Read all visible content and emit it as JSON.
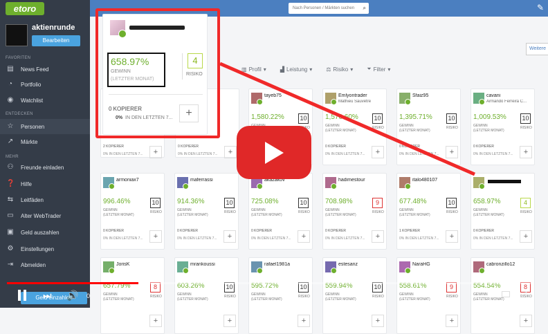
{
  "app": {
    "logo": "etoro"
  },
  "profile": {
    "name": "aktienrunde",
    "edit_label": "Bearbeiten"
  },
  "sidebar": {
    "section_favorites": "FAVORITEN",
    "section_discover": "ENTDECKEN",
    "section_more": "MEHR",
    "items": [
      {
        "label": "News Feed",
        "icon": "news-icon"
      },
      {
        "label": "Portfolio",
        "icon": "pie-chart-icon"
      },
      {
        "label": "Watchlist",
        "icon": "eye-icon"
      },
      {
        "label": "Personen",
        "icon": "star-icon"
      },
      {
        "label": "Märkte",
        "icon": "chart-icon"
      },
      {
        "label": "Freunde einladen",
        "icon": "people-icon"
      },
      {
        "label": "Hilfe",
        "icon": "help-icon"
      },
      {
        "label": "Leitfäden",
        "icon": "guide-icon"
      },
      {
        "label": "Alter WebTrader",
        "icon": "monitor-icon"
      },
      {
        "label": "Geld auszahlen",
        "icon": "money-icon"
      },
      {
        "label": "Einstellungen",
        "icon": "gear-icon"
      },
      {
        "label": "Abmelden",
        "icon": "logout-icon"
      }
    ],
    "deposit_label": "Geld einzahlen"
  },
  "search": {
    "placeholder": "Nach Personen / Märkten suchen"
  },
  "filters": {
    "profile": "Profil",
    "performance": "Leistung",
    "risk": "Risiko",
    "filter": "Filter",
    "more": "Weitere"
  },
  "highlight": {
    "gain": "658.97%",
    "gain_label": "GEWINN",
    "gain_period": "(LETZTER MONAT)",
    "risk": "4",
    "risk_label": "RISIKO",
    "copiers": "0 KOPIERER",
    "copiers_pct": "0%",
    "copiers_period": "IN DEN LETZTEN 7..."
  },
  "cards": [
    {
      "name": "tayeb75",
      "sub": "",
      "gain": "1,580.22%",
      "risk": "10",
      "copiers": "0 KOPIERER",
      "period": "0% IN DEN LETZTEN 7..."
    },
    {
      "name": "Emlyontrader",
      "sub": "Mathieu Sauvetre",
      "gain": "1,570.60%",
      "risk": "10",
      "copiers": "0 KOPIERER",
      "period": "0% IN DEN LETZTEN 7..."
    },
    {
      "name": "Sfaiz95",
      "sub": "",
      "gain": "1,395.71%",
      "risk": "10",
      "copiers": "0 KOPIERER",
      "period": "0% IN DEN LETZTEN 7..."
    },
    {
      "name": "cavani",
      "sub": "Armando Ferreira C...",
      "gain": "1,009.53%",
      "risk": "10",
      "copiers": "0 KOPIERER",
      "period": "0% IN DEN LETZTEN 7..."
    },
    {
      "name": "armoniax7",
      "sub": "",
      "gain": "996.46%",
      "risk": "10",
      "copiers": "0 KOPIERER",
      "period": "0% IN DEN LETZTEN 7..."
    },
    {
      "name": "maferrassi",
      "sub": "",
      "gain": "914.36%",
      "risk": "10",
      "copiers": "0 KOPIERER",
      "period": "0% IN DEN LETZTEN 7..."
    },
    {
      "name": "akazakov",
      "sub": "",
      "gain": "725.08%",
      "risk": "10",
      "copiers": "0 KOPIERER",
      "period": "0% IN DEN LETZTEN 7..."
    },
    {
      "name": "hadimestour",
      "sub": "",
      "gain": "708.98%",
      "risk": "9",
      "copiers": "0 KOPIERER",
      "period": "0% IN DEN LETZTEN 7..."
    },
    {
      "name": "italo480107",
      "sub": "",
      "gain": "677.48%",
      "risk": "10",
      "copiers": "1 KOPIERER",
      "period": "0% IN DEN LETZTEN 7..."
    },
    {
      "name": "",
      "sub": "",
      "gain": "658.97%",
      "risk": "4",
      "copiers": "0 KOPIERER",
      "period": "0% IN DEN LETZTEN 7..."
    },
    {
      "name": "JorisK",
      "sub": "",
      "gain": "657.79%",
      "risk": "8",
      "copiers": "",
      "period": ""
    },
    {
      "name": "mrankoussi",
      "sub": "",
      "gain": "603.26%",
      "risk": "10",
      "copiers": "",
      "period": ""
    },
    {
      "name": "rafael1981a",
      "sub": "",
      "gain": "595.72%",
      "risk": "10",
      "copiers": "",
      "period": ""
    },
    {
      "name": "estesanz",
      "sub": "",
      "gain": "559.94%",
      "risk": "10",
      "copiers": "",
      "period": ""
    },
    {
      "name": "NaraHG",
      "sub": "",
      "gain": "558.61%",
      "risk": "9",
      "copiers": "",
      "period": ""
    },
    {
      "name": "cabronzillo12",
      "sub": "",
      "gain": "554.54%",
      "risk": "8",
      "copiers": "",
      "period": ""
    }
  ],
  "row1_partial": {
    "copiers": "2 KOPIERER",
    "copiers_b": "0 KOPIERER",
    "period": "0% IN DEN LETZTEN 7..."
  },
  "labels": {
    "gewinn": "GEWINN",
    "period": "(LETZTER MONAT)",
    "risiko": "RISIKO",
    "plus": "+"
  },
  "video": {
    "time": "0",
    "progress": 0.25
  },
  "colors": {
    "accent": "#6eaf2d",
    "highlight": "#f02929",
    "topbar": "#4b7fc0"
  }
}
